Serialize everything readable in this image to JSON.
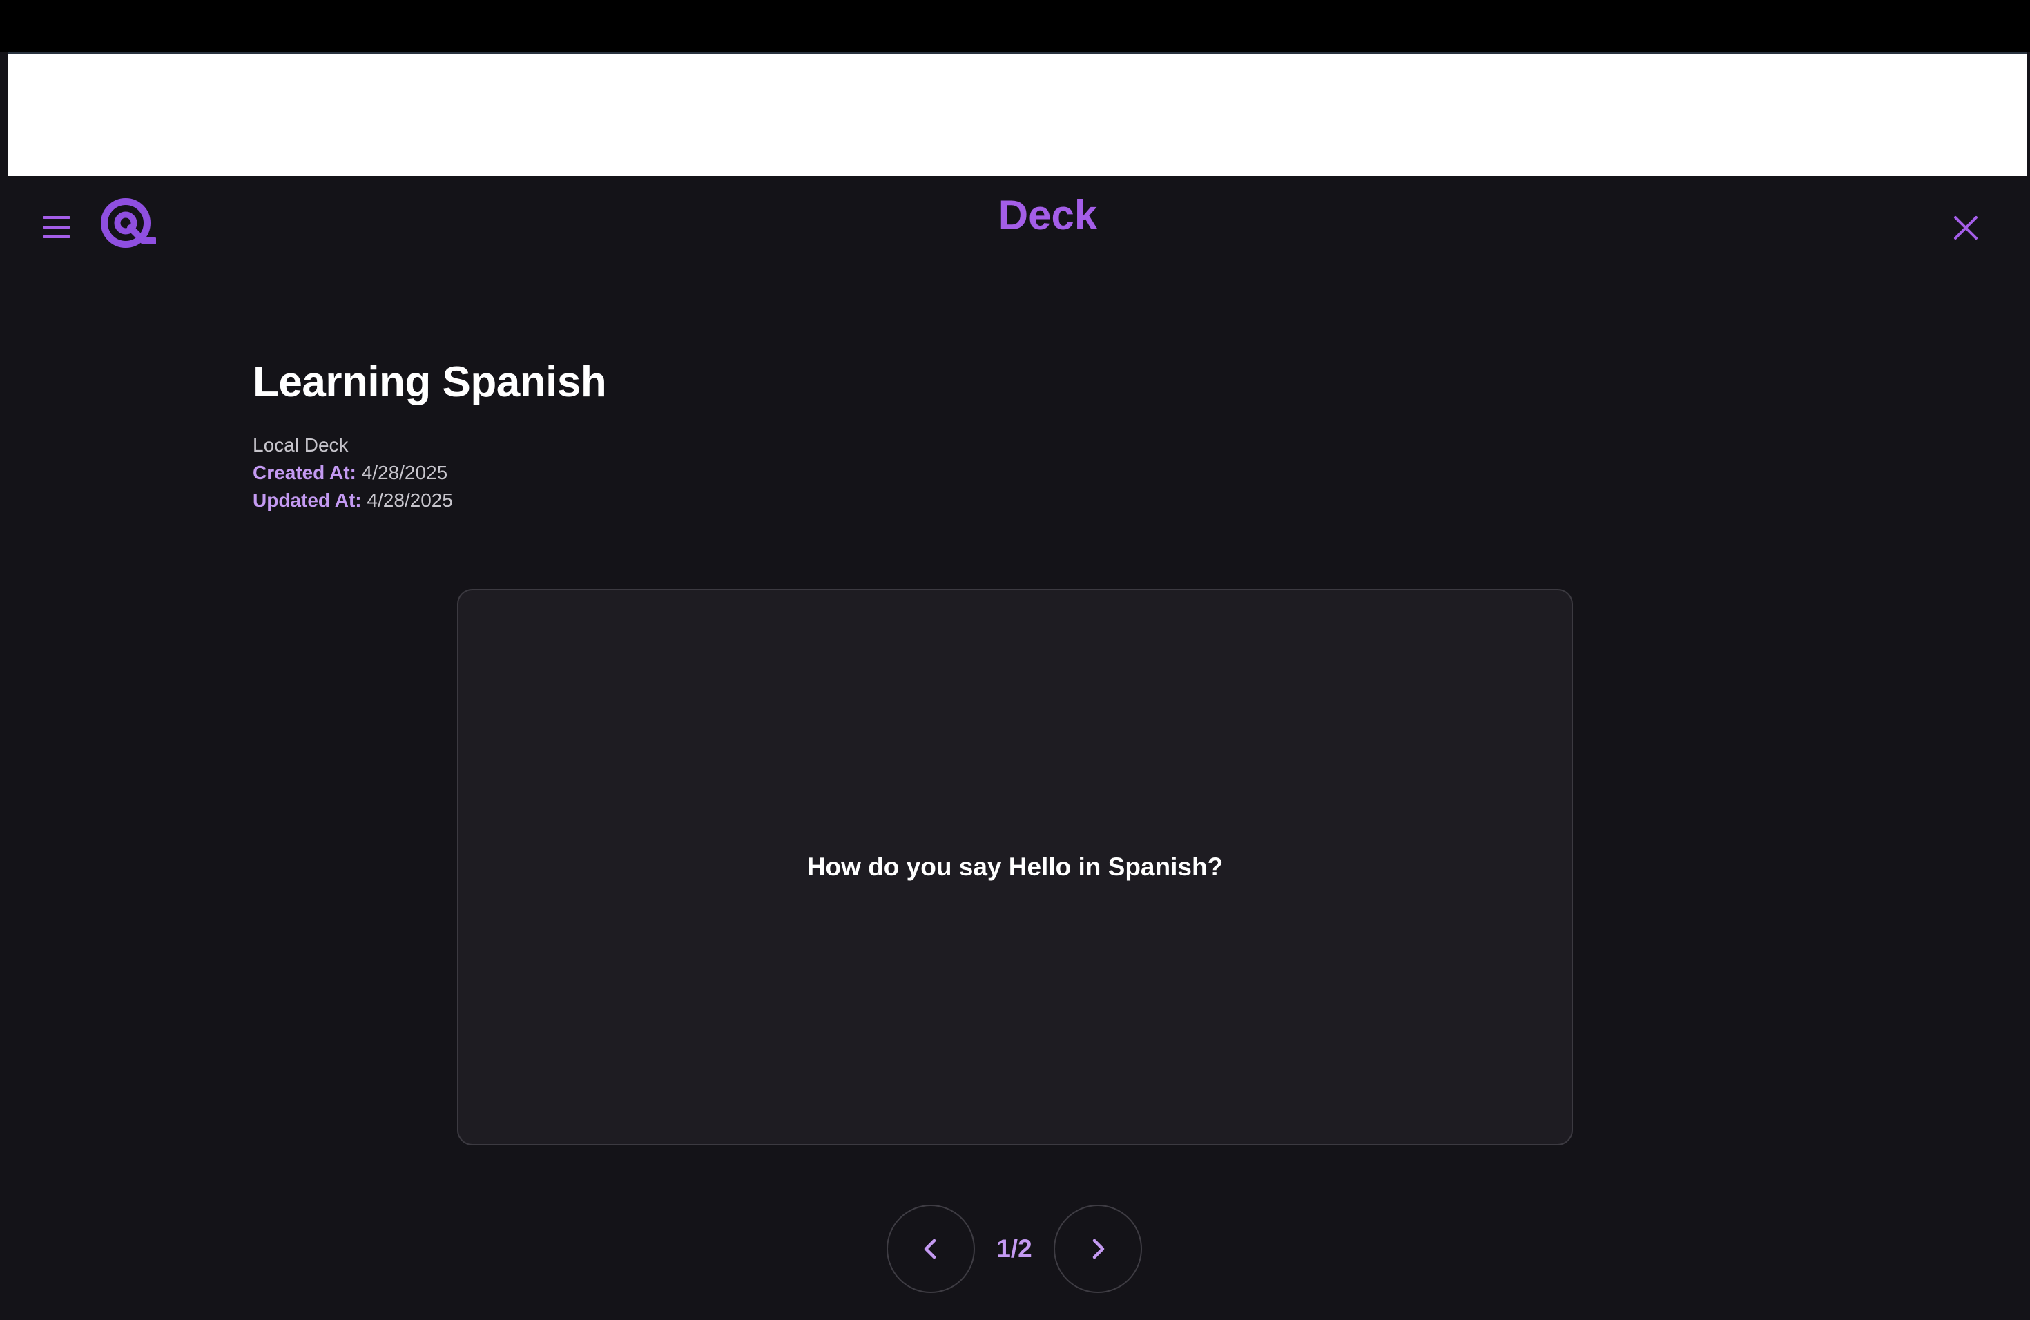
{
  "header": {
    "title": "Deck",
    "menu_icon": "hamburger-menu-icon",
    "logo_icon": "q-logo-icon",
    "close_icon": "close-icon"
  },
  "deck": {
    "title": "Learning Spanish",
    "type": "Local Deck",
    "created_label": "Created At:",
    "created_value": "4/28/2025",
    "updated_label": "Updated At:",
    "updated_value": "4/28/2025"
  },
  "card": {
    "question": "How do you say Hello in Spanish?"
  },
  "pager": {
    "counter": "1/2",
    "prev_icon": "chevron-left-icon",
    "next_icon": "chevron-right-icon"
  },
  "colors": {
    "accent": "#a45ee8",
    "accent_light": "#c49af2",
    "background": "#141318",
    "card": "#1e1c22"
  }
}
